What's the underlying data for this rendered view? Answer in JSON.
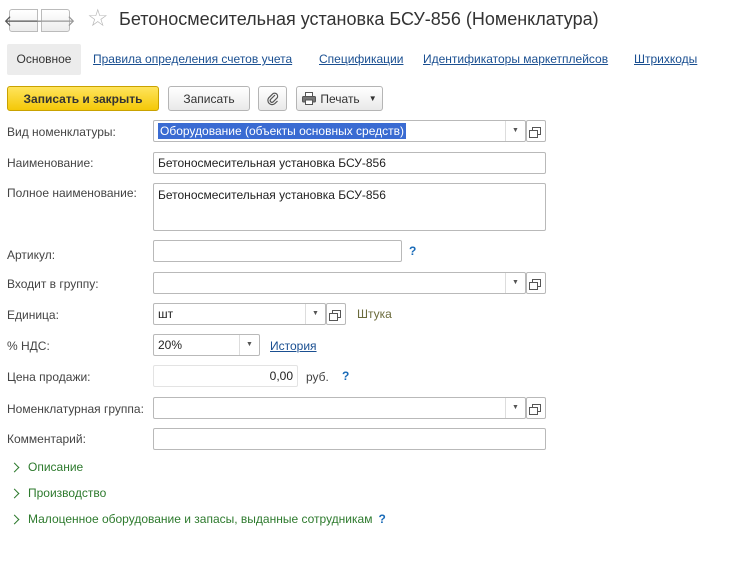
{
  "header": {
    "back_icon": "arrow-left-icon",
    "forward_icon": "arrow-right-icon",
    "favorite_icon": "star-icon",
    "title": "Бетоносмесительная установка БСУ-856 (Номенклатура)"
  },
  "tabs": [
    {
      "label": "Основное",
      "active": true
    },
    {
      "label": "Правила определения счетов учета"
    },
    {
      "label": "Спецификации"
    },
    {
      "label": "Идентификаторы маркетплейсов"
    },
    {
      "label": "Штрихкоды"
    }
  ],
  "toolbar": {
    "save_close_label": "Записать и закрыть",
    "save_label": "Записать",
    "attach_icon": "paperclip-icon",
    "print_label": "Печать",
    "print_icon": "printer-icon"
  },
  "form": {
    "vid": {
      "label": "Вид номенклатуры:",
      "value": "Оборудование (объекты основных средств)"
    },
    "name": {
      "label": "Наименование:",
      "value": "Бетоносмесительная установка БСУ-856"
    },
    "full_name": {
      "label": "Полное наименование:",
      "value": "Бетоносмесительная установка БСУ-856"
    },
    "article": {
      "label": "Артикул:",
      "value": "",
      "help": "?"
    },
    "group": {
      "label": "Входит в группу:",
      "value": ""
    },
    "unit": {
      "label": "Единица:",
      "value": "шт",
      "hint": "Штука"
    },
    "vat": {
      "label": "% НДС:",
      "value": "20%",
      "history_link": "История"
    },
    "price": {
      "label": "Цена продажи:",
      "value": "0,00",
      "currency": "руб.",
      "help": "?"
    },
    "nom_group": {
      "label": "Номенклатурная группа:",
      "value": ""
    },
    "comment": {
      "label": "Комментарий:",
      "value": ""
    }
  },
  "groups": [
    {
      "label": "Описание"
    },
    {
      "label": "Производство"
    },
    {
      "label": "Малоценное оборудование и запасы, выданные сотрудникам",
      "help": "?"
    }
  ],
  "colors": {
    "primary_button": "#f4c808",
    "link": "#1a4f91",
    "group_header": "#2d7a2d",
    "selection": "#3a6bd2"
  }
}
